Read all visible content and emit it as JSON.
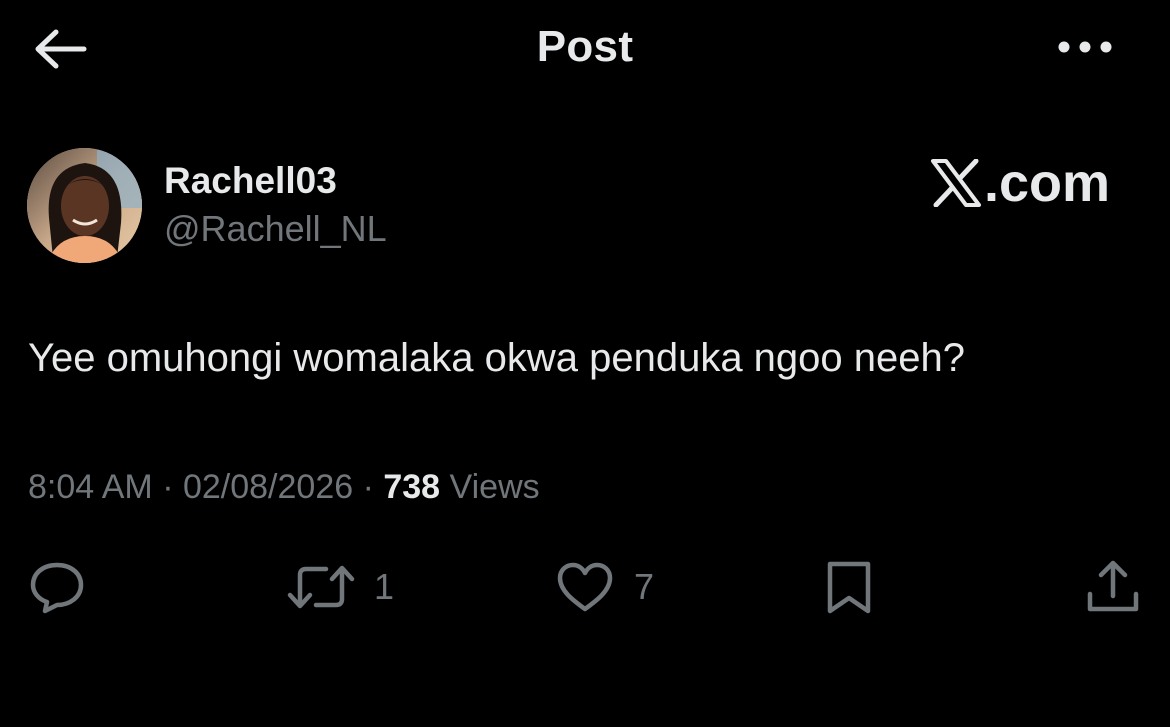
{
  "header": {
    "title": "Post",
    "back_icon": "arrow-left-icon",
    "more_icon": "more-horizontal-icon"
  },
  "post": {
    "author": {
      "display_name": "Rachell03",
      "handle": "@Rachell_NL"
    },
    "watermark": ".com",
    "text": "Yee omuhongi womalaka okwa penduka ngoo neeh?",
    "meta": {
      "time": "8:04 AM",
      "separator": " · ",
      "date": "02/08/2026",
      "views_count": "738",
      "views_label": "Views"
    },
    "actions": {
      "reply_icon": "reply-bubble-icon",
      "repost_icon": "repost-icon",
      "repost_count": "1",
      "like_icon": "heart-icon",
      "like_count": "7",
      "bookmark_icon": "bookmark-icon",
      "share_icon": "share-icon"
    }
  },
  "colors": {
    "background": "#000000",
    "primary_text": "#e7e9ea",
    "secondary_text": "#71767b"
  }
}
